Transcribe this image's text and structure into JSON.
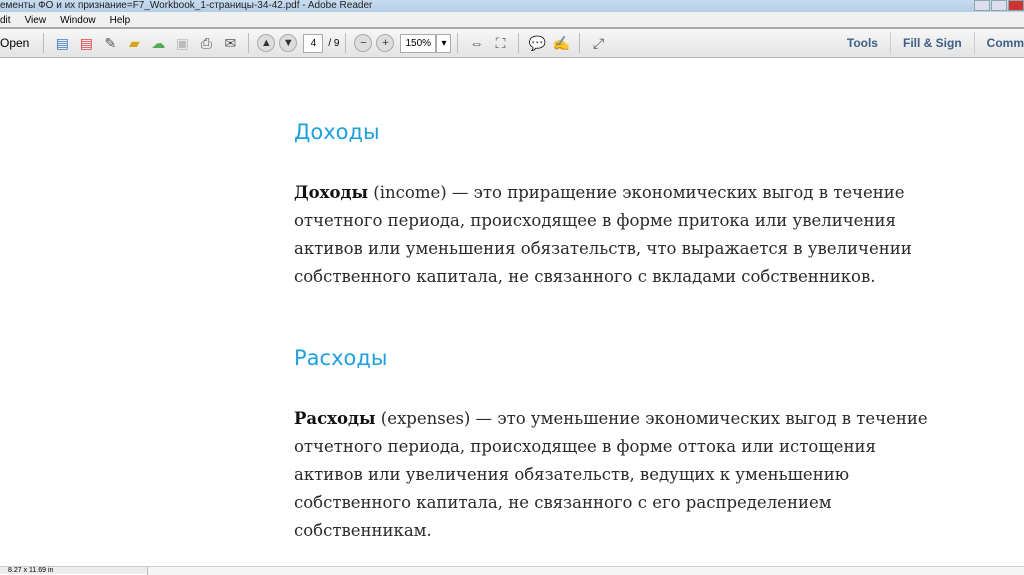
{
  "window": {
    "title": "ементы ФО и их признание=F7_Workbook_1-страницы-34-42.pdf - Adobe Reader"
  },
  "menu": [
    "dit",
    "View",
    "Window",
    "Help"
  ],
  "toolbar": {
    "open": "Open",
    "page_current": "4",
    "page_total": "/ 9",
    "zoom": "150%",
    "tools": "Tools",
    "fill_sign": "Fill & Sign",
    "comment": "Comm"
  },
  "content": {
    "heading1": "Доходы",
    "p1_bold": "Доходы",
    "p1_text": " (income) — это приращение экономических выгод в течение отчетного периода, происходящее в форме притока или увеличения активов или уменьшения обязательств, что выражается в увеличении собственного капитала, не связанного с вкладами собственников.",
    "heading2": "Расходы",
    "p2_bold": "Расходы",
    "p2_text": " (expenses) — это уменьшение экономических выгод в течение отчетного периода, происходящее в форме оттока или истощения активов или увеличения обязательств, ведущих к уменьшению собственного капитала, не связанного с его распределением собственникам."
  },
  "status": {
    "page_size": "8.27 x 11.69 in"
  },
  "colors": {
    "heading": "#1ea0e0",
    "tool_text": "#3e5f87"
  }
}
